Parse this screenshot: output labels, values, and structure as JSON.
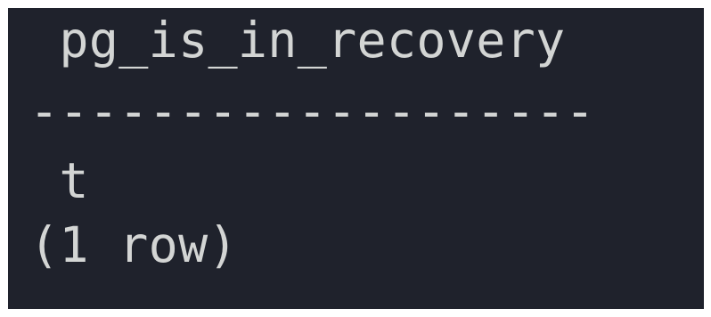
{
  "query_result": {
    "column_header": " pg_is_in_recovery",
    "separator": "-------------------",
    "rows": [
      {
        "pg_is_in_recovery": " t"
      }
    ],
    "row_count_text": "(1 row)"
  },
  "colors": {
    "background": "#1f222c",
    "text": "#d3d5d4"
  }
}
